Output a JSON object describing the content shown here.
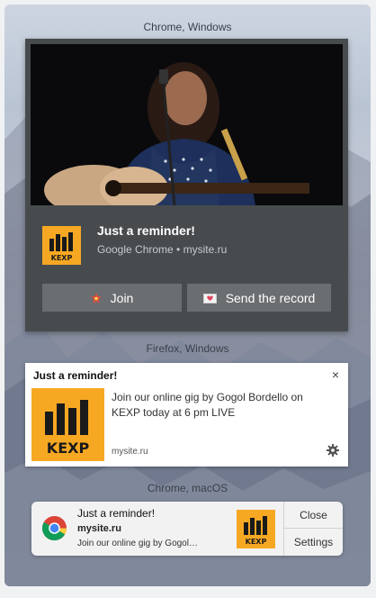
{
  "sections": {
    "chrome_windows": "Chrome, Windows",
    "firefox_windows": "Firefox, Windows",
    "chrome_macos": "Chrome, macOS"
  },
  "logo_text": "KEXP",
  "chrome_windows": {
    "title": "Just a reminder!",
    "subtitle": "Google Chrome • mysite.ru",
    "buttons": {
      "join": "Join",
      "send": "Send the record"
    },
    "photo_icon": "musician-photo"
  },
  "firefox_windows": {
    "title": "Just a reminder!",
    "close": "×",
    "body": "Join our online gig by Gogol Bordello on KEXP today at 6 pm LIVE",
    "site": "mysite.ru"
  },
  "chrome_macos": {
    "title": "Just a reminder!",
    "site": "mysite.ru",
    "body": "Join our online gig by Gogol…",
    "actions": {
      "close": "Close",
      "settings": "Settings"
    }
  },
  "colors": {
    "kexp_yellow": "#f7a823",
    "chrome_dark": "#474b4d",
    "chrome_button": "#6a6e71"
  }
}
